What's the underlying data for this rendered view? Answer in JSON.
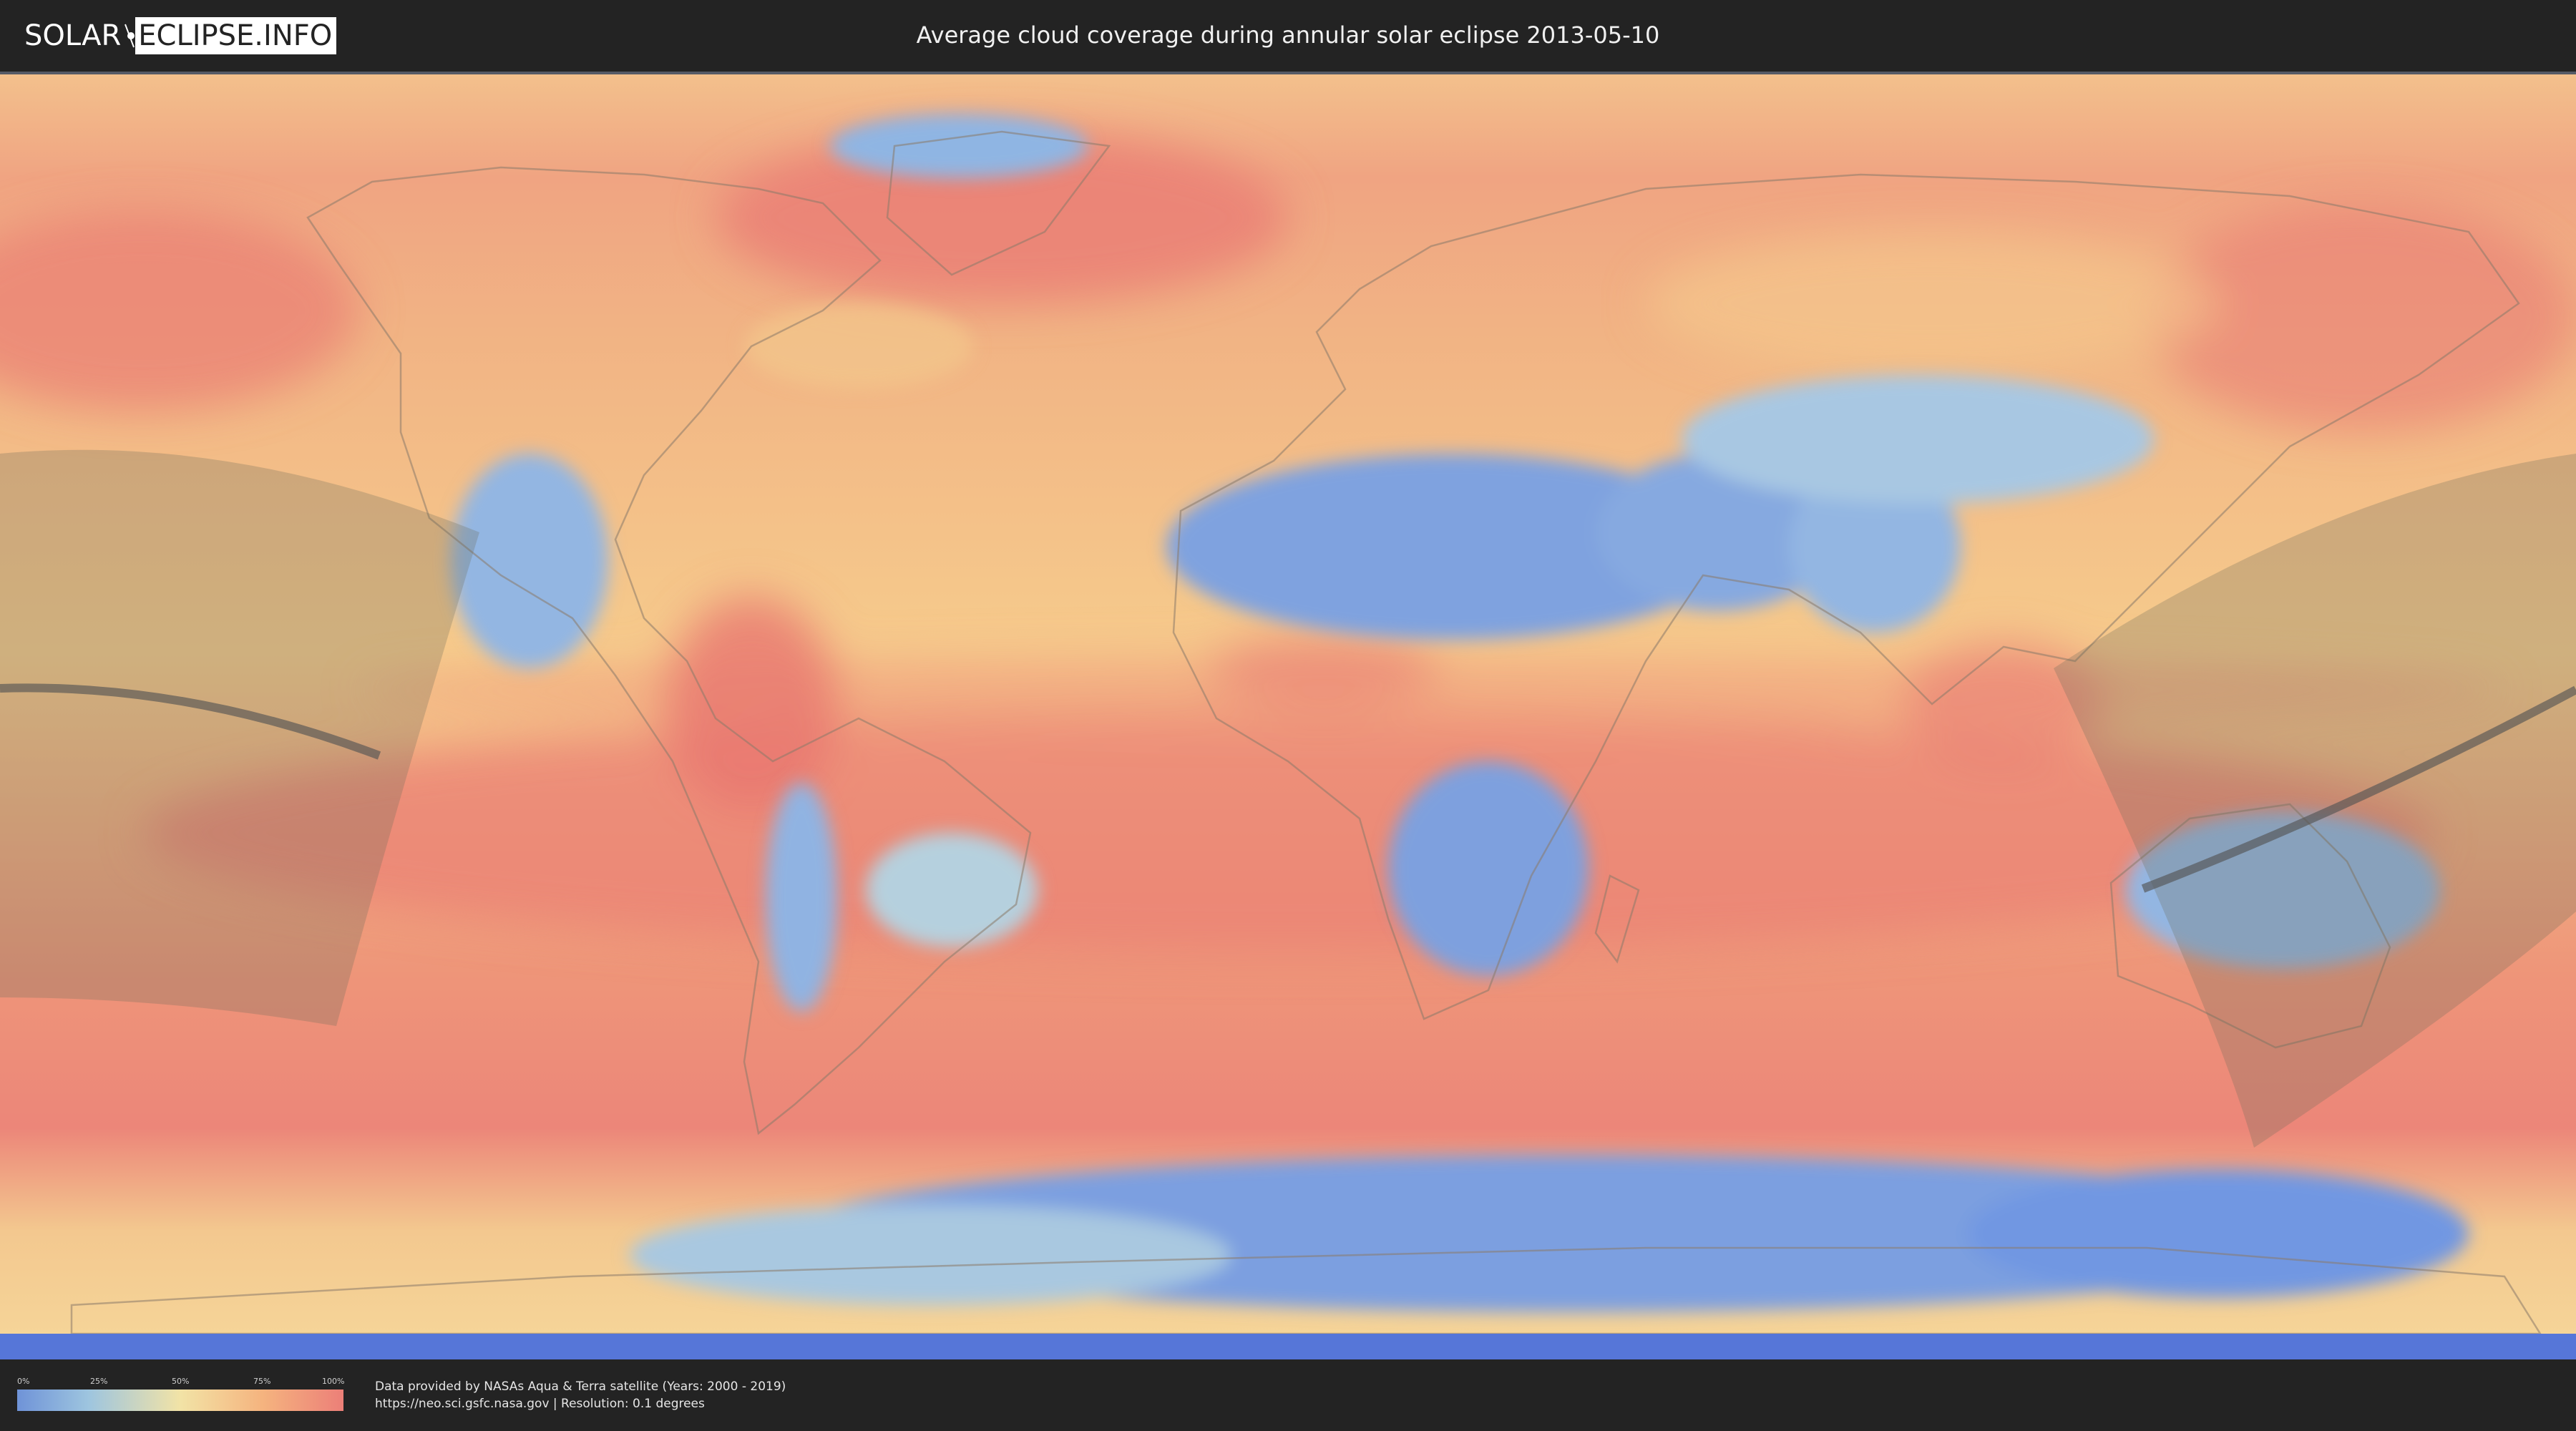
{
  "header": {
    "logo_left": "SOLAR",
    "logo_right": "ECLIPSE.INFO",
    "title": "Average cloud coverage during annular solar eclipse 2013-05-10"
  },
  "map": {
    "layer": "average-cloud-coverage",
    "eclipse_path_visible": true,
    "colors": {
      "clear": "#6f93d8",
      "low": "#9ec5df",
      "mid": "#f2e3a6",
      "high": "#f5b47f",
      "overcast": "#ec7f78"
    }
  },
  "legend": {
    "ticks": [
      "0%",
      "25%",
      "50%",
      "75%",
      "100%"
    ]
  },
  "credits": {
    "line1": "Data provided by NASAs Aqua & Terra satellite (Years: 2000 - 2019)",
    "line2": "https://neo.sci.gsfc.nasa.gov | Resolution: 0.1 degrees"
  }
}
